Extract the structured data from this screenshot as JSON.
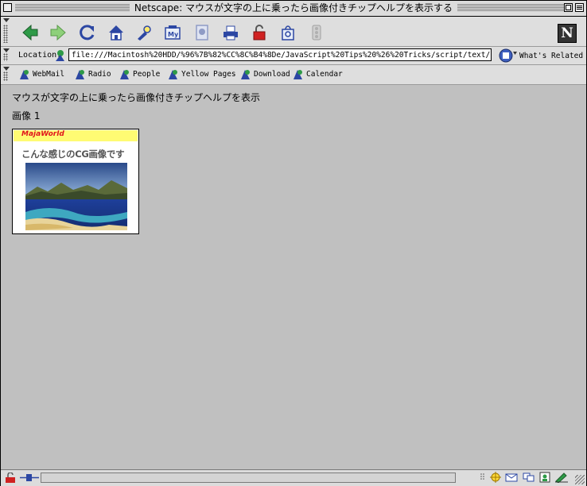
{
  "window": {
    "title": "Netscape: マウスが文字の上に乗ったら画像付きチップヘルプを表示する"
  },
  "toolbar": {
    "buttons": [
      {
        "name": "back",
        "icon": "back-arrow-icon",
        "color": "#2e9a47"
      },
      {
        "name": "forward",
        "icon": "forward-arrow-icon",
        "color": "#8ed07a"
      },
      {
        "name": "reload",
        "icon": "reload-icon",
        "color": "#2c47a3"
      },
      {
        "name": "home",
        "icon": "home-icon",
        "color": "#2c47a3"
      },
      {
        "name": "search",
        "icon": "search-flashlight-icon",
        "color": "#2c47a3"
      },
      {
        "name": "my-netscape",
        "icon": "my-netscape-icon",
        "color": "#2c47a3"
      },
      {
        "name": "images",
        "icon": "images-icon",
        "color": "#8f9bc5"
      },
      {
        "name": "print",
        "icon": "print-icon",
        "color": "#2c47a3"
      },
      {
        "name": "security",
        "icon": "security-lock-icon",
        "color": "#d02121"
      },
      {
        "name": "shop",
        "icon": "shop-bag-icon",
        "color": "#2c47a3"
      },
      {
        "name": "stop",
        "icon": "stop-icon",
        "color": "#a0a0a0"
      }
    ]
  },
  "location": {
    "label": "Location:",
    "url": "file:///Macintosh%20HDD/%96%7B%82%CC%8C%B4%8De/JavaScript%20Tips%20%26%20Tricks/script/text/",
    "related_label": "What's Related"
  },
  "personal_toolbar": {
    "items": [
      "WebMail",
      "Radio",
      "People",
      "Yellow Pages",
      "Download",
      "Calendar"
    ]
  },
  "content": {
    "heading": "マウスが文字の上に乗ったら画像付きチップヘルプを表示",
    "image_caption": "画像 1",
    "thumbnail": {
      "brand": "MajaWorld",
      "phrase": "こんな感じのCG画像です"
    }
  },
  "colors": {
    "window_bg": "#c0c0c0",
    "chrome_bg": "#dedede",
    "brand_red": "#e0141e",
    "brand_band": "#fffb73"
  }
}
